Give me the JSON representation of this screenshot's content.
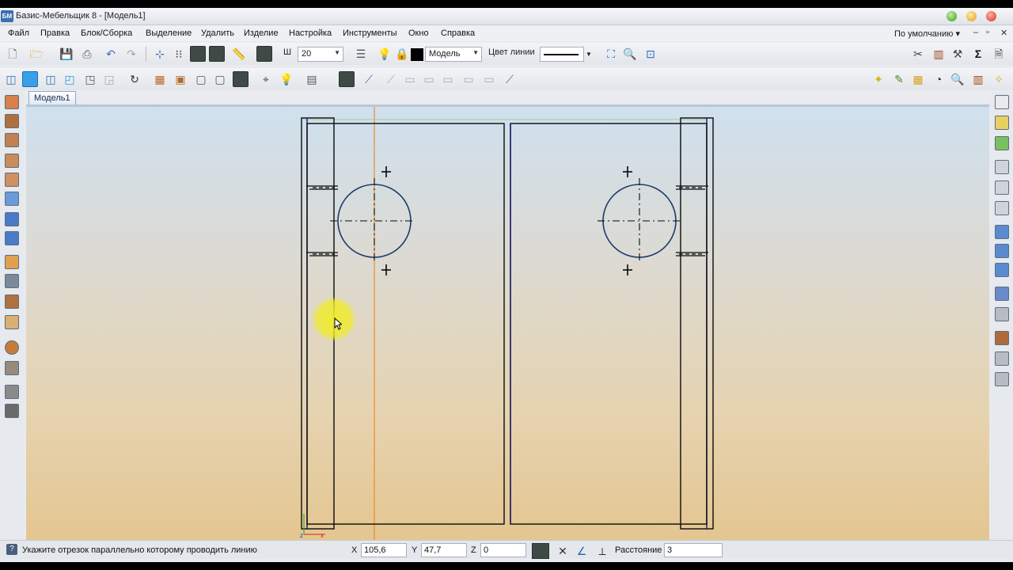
{
  "window": {
    "title": "Базис-Мебельщик 8 - [Модель1]",
    "app_badge": "БМ"
  },
  "menu": {
    "items": [
      "Файл",
      "Правка",
      "Блок/Сборка",
      "Выделение",
      "Удалить",
      "Изделие",
      "Настройка",
      "Инструменты",
      "Окно",
      "Справка"
    ],
    "preset": "По умолчанию",
    "mdi_min": "‒",
    "mdi_restore": "▫",
    "mdi_close": "✕"
  },
  "toolbar": {
    "step_label": "Ш",
    "step_value": "20",
    "layer_value": "Модель",
    "line_color_label": "Цвет линии"
  },
  "document": {
    "tab_label": "Модель1"
  },
  "status": {
    "message": "Укажите отрезок параллельно которому проводить линию",
    "x_label": "X",
    "x_value": "105,6",
    "y_label": "Y",
    "y_value": "47,7",
    "z_label": "Z",
    "z_value": "0",
    "distance_label": "Расстояние",
    "distance_value": "3"
  },
  "colors": {
    "drawing_line": "#0a0a0a",
    "panel_edge": "#1a1a6a",
    "circle": "#1d3b6b",
    "guide_line": "#f08a24",
    "cursor_highlight": "#f0ec28"
  },
  "icons": {
    "axis_x": "x-axis-marker",
    "axis_z": "z-axis-marker"
  }
}
